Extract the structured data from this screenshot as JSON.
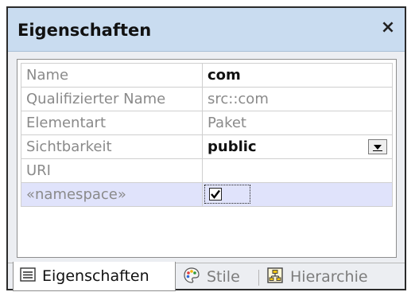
{
  "window": {
    "title": "Eigenschaften",
    "close_symbol": "×"
  },
  "properties": [
    {
      "name": "Name",
      "value": "com",
      "editable": true
    },
    {
      "name": "Qualifizierter Name",
      "value": "src::com",
      "editable": false
    },
    {
      "name": "Elementart",
      "value": "Paket",
      "editable": false
    },
    {
      "name": "Sichtbarkeit",
      "value": "public",
      "editable": true,
      "control": "dropdown"
    },
    {
      "name": "URI",
      "value": "",
      "editable": true
    },
    {
      "name": "«namespace»",
      "value": "",
      "control": "checkbox",
      "checked": true,
      "selected": true
    }
  ],
  "tabs": [
    {
      "label": "Eigenschaften",
      "icon": "properties-list-icon",
      "active": true
    },
    {
      "label": "Stile",
      "icon": "palette-icon",
      "active": false
    },
    {
      "label": "Hierarchie",
      "icon": "hierarchy-icon",
      "active": false
    }
  ],
  "colors": {
    "titlebar": "#c9dcf0",
    "selected_row": "#e0e3fb",
    "panel": "#eceef2"
  }
}
